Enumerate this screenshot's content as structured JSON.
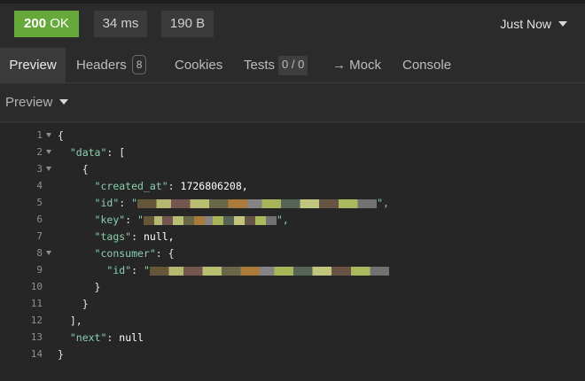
{
  "response": {
    "status_code": "200",
    "status_text": "OK",
    "time": "34 ms",
    "size": "190 B",
    "when": "Just Now",
    "status_color": "#67a83a"
  },
  "tabs": [
    {
      "label": "Preview",
      "active": true
    },
    {
      "label": "Headers",
      "count": "8"
    },
    {
      "label": "Cookies"
    },
    {
      "label": "Tests",
      "count": "0 / 0"
    },
    {
      "label": "→ Mock"
    },
    {
      "label": "Console"
    }
  ],
  "preview_mode": "Preview",
  "code_lines": [
    {
      "n": "1",
      "fold": true
    },
    {
      "n": "2",
      "fold": true
    },
    {
      "n": "3",
      "fold": true
    },
    {
      "n": "4"
    },
    {
      "n": "5"
    },
    {
      "n": "6"
    },
    {
      "n": "7"
    },
    {
      "n": "8",
      "fold": true
    },
    {
      "n": "9"
    },
    {
      "n": "10"
    },
    {
      "n": "11"
    },
    {
      "n": "12"
    },
    {
      "n": "13"
    },
    {
      "n": "14"
    }
  ],
  "json": {
    "open_brace": "{",
    "data_key": "\"data\"",
    "colon": ":",
    "open_bracket": "[",
    "created_at_key": "\"created_at\"",
    "created_at_value": "1726806208,",
    "id_key": "\"id\"",
    "id_open_quote": "\"",
    "id_close": "\",",
    "key_key": "\"key\"",
    "key_open_quote": "\"",
    "key_close": "\",",
    "tags_key": "\"tags\"",
    "tags_value": "null,",
    "consumer_key": "\"consumer\"",
    "consumer_open": "{",
    "consumer_id_key": "\"id\"",
    "consumer_id_open_quote": "\"",
    "close_brace": "}",
    "close_bracket": "],",
    "next_key": "\"next\"",
    "next_value": "null"
  }
}
